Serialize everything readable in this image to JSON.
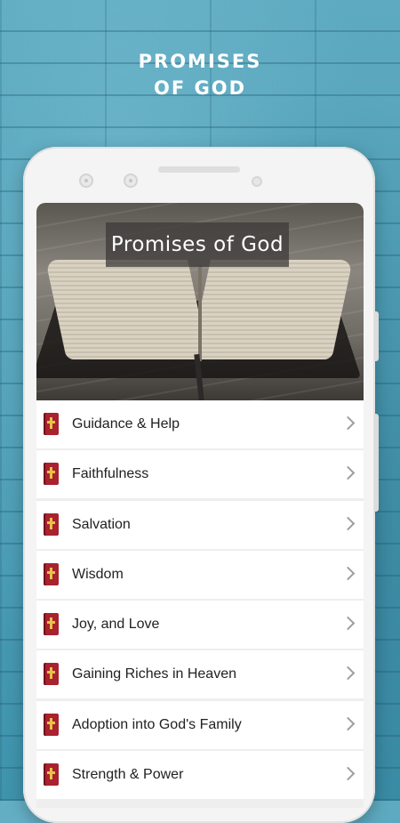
{
  "headline": {
    "line1": "PROMISES",
    "line2": "OF GOD"
  },
  "banner": {
    "title": "Promises of God"
  },
  "menu": {
    "item_icon": "bible-icon",
    "chevron_icon": "chevron-right-icon",
    "items": [
      {
        "label": "Guidance & Help"
      },
      {
        "label": "Faithfulness"
      },
      {
        "label": "Salvation"
      },
      {
        "label": "Wisdom"
      },
      {
        "label": "Joy, and Love"
      },
      {
        "label": "Gaining Riches in Heaven"
      },
      {
        "label": "Adoption into God's Family"
      },
      {
        "label": "Strength & Power"
      }
    ]
  },
  "colors": {
    "background": "#4a9bb2",
    "icon_red": "#a8222f",
    "icon_gold": "#e8c24a",
    "text": "#212121",
    "chevron": "#9e9e9e"
  }
}
